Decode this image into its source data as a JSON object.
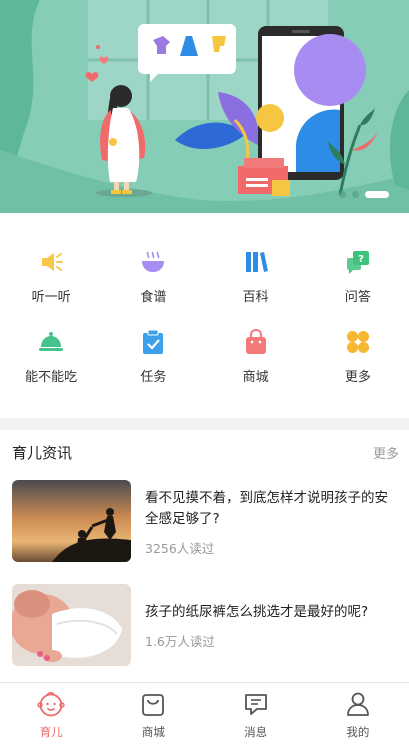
{
  "banner": {
    "slides": 3,
    "active_slide": 3
  },
  "grid": [
    {
      "label": "听一听",
      "icon": "speaker-icon",
      "color": "#f7c84a"
    },
    {
      "label": "食谱",
      "icon": "bowl-icon",
      "color": "#a98cf2"
    },
    {
      "label": "百科",
      "icon": "books-icon",
      "color": "#2d8ce6"
    },
    {
      "label": "问答",
      "icon": "chat-question-icon",
      "color": "#3fc27d"
    },
    {
      "label": "能不能吃",
      "icon": "food-cover-icon",
      "color": "#45c38d"
    },
    {
      "label": "任务",
      "icon": "clipboard-check-icon",
      "color": "#3da0ea"
    },
    {
      "label": "商城",
      "icon": "shopping-bag-icon",
      "color": "#f37a7a"
    },
    {
      "label": "更多",
      "icon": "more-icon",
      "color": "#f6b731"
    }
  ],
  "news": {
    "title": "育儿资讯",
    "more": "更多",
    "items": [
      {
        "title": "看不见摸不着，到底怎样才说明孩子的安全感足够了?",
        "reads": "3256人读过"
      },
      {
        "title": "孩子的纸尿裤怎么挑选才是最好的呢?",
        "reads": "1.6万人读过"
      }
    ]
  },
  "tabbar": [
    {
      "label": "育儿",
      "icon": "baby-face-icon",
      "active": true
    },
    {
      "label": "商城",
      "icon": "shopping-bag-icon",
      "active": false
    },
    {
      "label": "消息",
      "icon": "message-icon",
      "active": false
    },
    {
      "label": "我的",
      "icon": "user-icon",
      "active": false
    }
  ],
  "colors": {
    "accent": "#f06a6a",
    "banner_bg": "#86cdb8"
  }
}
